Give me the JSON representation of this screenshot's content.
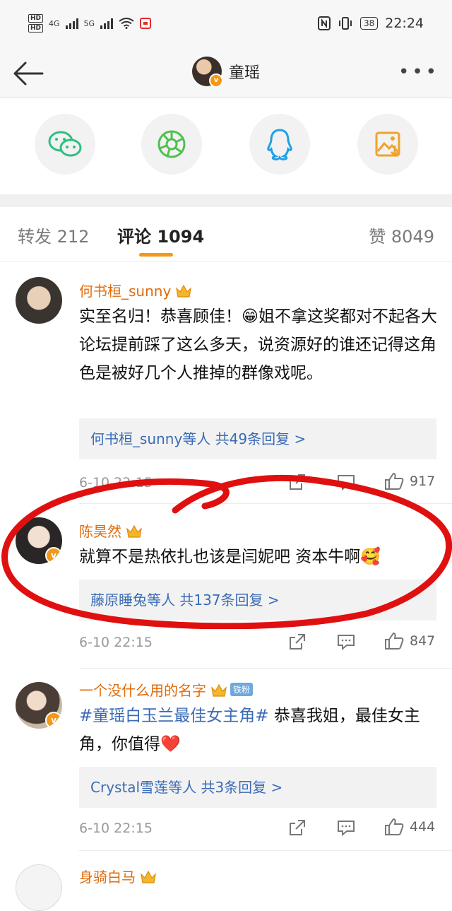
{
  "status_bar": {
    "network": "4G",
    "network2": "5G",
    "battery": "38",
    "time": "22:24"
  },
  "header": {
    "title": "童瑶"
  },
  "tabs": [
    {
      "label": "转发 212"
    },
    {
      "label": "评论 1094"
    },
    {
      "label": "赞 8049"
    }
  ],
  "comments": [
    {
      "username": "何书桓_sunny",
      "text": "实至名归！恭喜顾佳！😁姐不拿这奖都对不起各大论坛提前踩了这么多天，说资源好的谁还记得这角色是被好几个人推掉的群像戏呢。",
      "reply_summary": "何书桓_sunny等人 共49条回复 >",
      "time": "6-10 22:15",
      "likes": "917"
    },
    {
      "username": "陈昊然",
      "text": "就算不是热依扎也该是闫妮吧 资本牛啊🥰",
      "reply_summary": "藤原睡兔等人 共137条回复 >",
      "time": "6-10 22:15",
      "likes": "847"
    },
    {
      "username": "一个没什么用的名字",
      "fan_tag": "铁粉",
      "topic": "#童瑶白玉兰最佳女主角#",
      "text": " 恭喜我姐，最佳女主角，你值得❤️",
      "reply_summary": "Crystal雪莲等人 共3条回复 >",
      "time": "6-10 22:15",
      "likes": "444"
    },
    {
      "username": "身骑白马"
    }
  ],
  "colors": {
    "accent": "#f39817",
    "username": "#e06b0b",
    "link": "#3a6bb5",
    "annotation": "#e01010"
  },
  "icons": [
    "back-arrow-icon",
    "more-icon",
    "wechat-icon",
    "moments-icon",
    "qq-icon",
    "save-image-icon",
    "share-icon",
    "comment-icon",
    "like-icon"
  ]
}
